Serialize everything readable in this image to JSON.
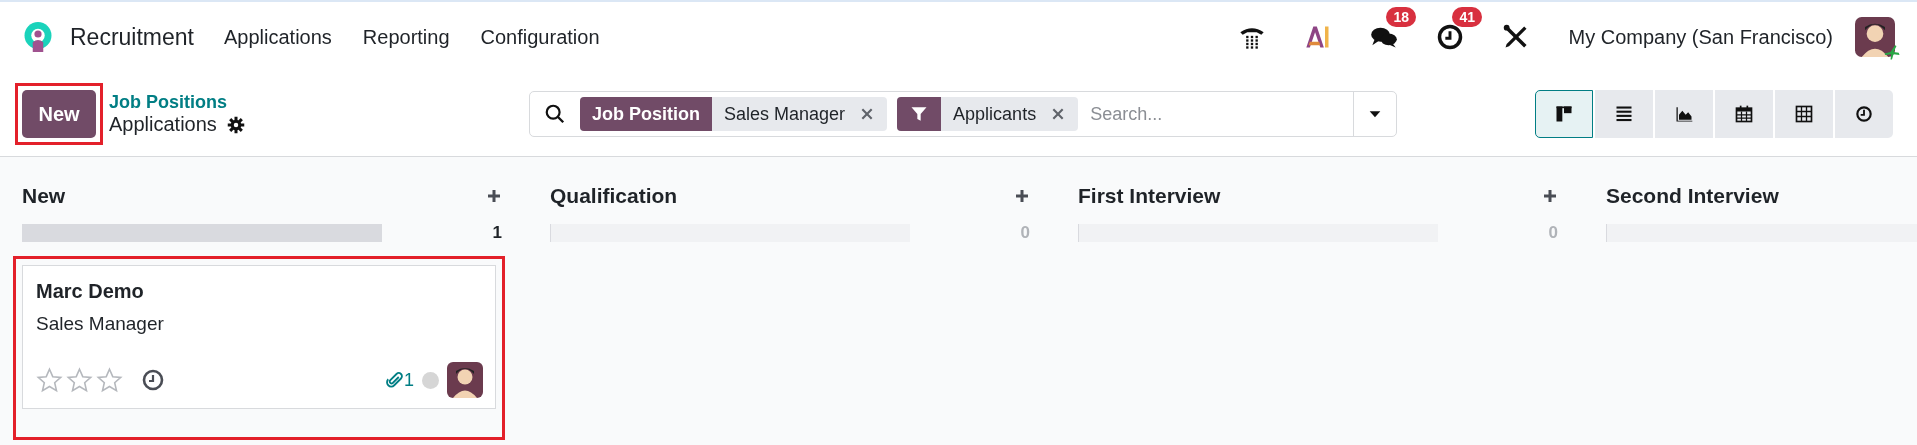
{
  "navbar": {
    "app_name": "Recruitment",
    "menu": [
      "Applications",
      "Reporting",
      "Configuration"
    ],
    "systray": [
      {
        "kind": "phone"
      },
      {
        "kind": "ai"
      },
      {
        "kind": "messages",
        "badge": "18"
      },
      {
        "kind": "activities",
        "badge": "41"
      },
      {
        "kind": "tools"
      }
    ],
    "company": "My Company (San Francisco)"
  },
  "control_panel": {
    "new_button": {
      "label": "New",
      "highlighted": true
    },
    "breadcrumb": "Job Positions",
    "title": "Applications",
    "search": {
      "facets": [
        {
          "kind": "field",
          "label": "Job Position",
          "value": "Sales Manager"
        },
        {
          "kind": "filter",
          "value": "Applicants"
        }
      ],
      "placeholder": "Search..."
    },
    "views": [
      {
        "kind": "kanban",
        "selected": true
      },
      {
        "kind": "list",
        "selected": false
      },
      {
        "kind": "graph",
        "selected": false
      },
      {
        "kind": "calendar",
        "selected": false
      },
      {
        "kind": "pivot",
        "selected": false
      },
      {
        "kind": "activity",
        "selected": false
      }
    ]
  },
  "columns": [
    {
      "title": "New",
      "count": "1",
      "level": 1,
      "cards": [
        {
          "name": "Marc Demo",
          "job": "Sales Manager",
          "stars": 0,
          "attachments": "1",
          "color": "#d6d6d6",
          "highlighted": true
        }
      ]
    },
    {
      "title": "Qualification",
      "count": "0",
      "level": 0
    },
    {
      "title": "First Interview",
      "count": "0",
      "level": 0
    },
    {
      "title": "Second Interview",
      "level": 0
    }
  ]
}
